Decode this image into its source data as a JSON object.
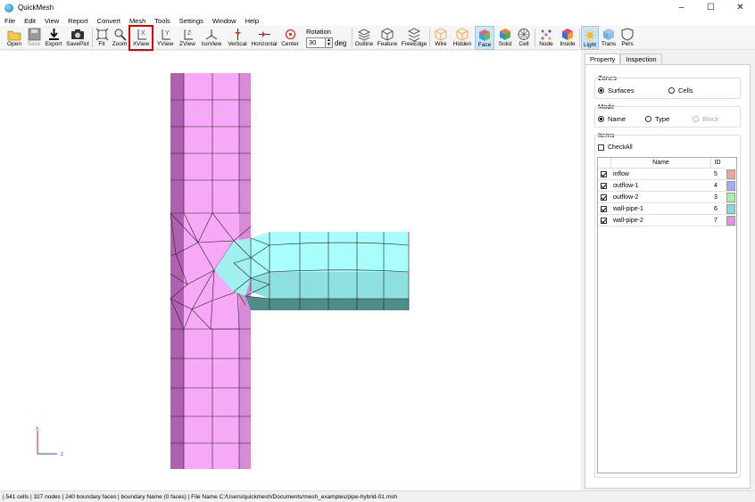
{
  "window": {
    "title": "QuickMesh",
    "minimize": "–",
    "maximize": "☐",
    "close": "✕"
  },
  "menu": [
    "File",
    "Edit",
    "View",
    "Report",
    "Convert",
    "Mesh",
    "Tools",
    "Settings",
    "Window",
    "Help"
  ],
  "toolbar": {
    "open": "Open",
    "save": "Save",
    "export": "Export",
    "savepict": "SavePict",
    "fit": "Fit",
    "zoom": "Zoom",
    "xview": "XView",
    "yview": "YView",
    "zview": "ZView",
    "isoview": "IsoView",
    "vertical": "Vertical",
    "horizontal": "Horizontal",
    "center": "Center",
    "outline": "Outline",
    "feature": "Feature",
    "freeedge": "FreeEdge",
    "wire": "Wire",
    "hidden": "Hidden",
    "face": "Face",
    "solid": "Solid",
    "cell": "Cell",
    "node": "Node",
    "inside": "Inside",
    "light": "Light",
    "trans": "Trans",
    "pers": "Pers"
  },
  "rotation": {
    "title": "Rotation",
    "value": "30",
    "unit": "deg"
  },
  "axes": {
    "x": "x",
    "z": "z"
  },
  "panel": {
    "tabs": [
      "Property",
      "Inspection"
    ],
    "zones": {
      "title": "Zones",
      "surfaces": "Surfaces",
      "cells": "Cells"
    },
    "mode": {
      "title": "Mode",
      "name": "Name",
      "type": "Type",
      "block": "Block"
    },
    "items": {
      "title": "Items",
      "check_all": "CheckAll",
      "col_name": "Name",
      "col_id": "ID",
      "rows": [
        {
          "name": "inflow",
          "id": "5",
          "color": "#f4a0a0"
        },
        {
          "name": "outflow-1",
          "id": "4",
          "color": "#a8a8f0"
        },
        {
          "name": "outflow-2",
          "id": "3",
          "color": "#a8f0a8"
        },
        {
          "name": "wall-pipe-1",
          "id": "6",
          "color": "#88d8d8"
        },
        {
          "name": "wall-pipe-2",
          "id": "7",
          "color": "#e890e8"
        }
      ]
    }
  },
  "status": "| 541 cells | 327 nodes | 240 boundary faces |  boundary Name  (0 faces) | File Name C:/Users/quickmesh/Documents/mesh_examples/pipe-hybrid-01.msh",
  "colors": {
    "pipe_pink": "#f7a8f7",
    "pipe_pink_dark": "#b060b0",
    "pipe_cyan": "#a8fdfd",
    "pipe_cyan_mid": "#8ee0e0",
    "pipe_teal_dark": "#4f8c8c",
    "highlight": "#e00000"
  }
}
